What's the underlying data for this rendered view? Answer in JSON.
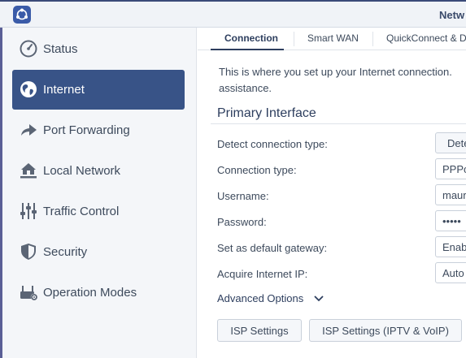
{
  "window": {
    "title": "Netw"
  },
  "sidebar": {
    "items": [
      {
        "label": "Status",
        "icon": "gauge-icon"
      },
      {
        "label": "Internet",
        "icon": "globe-icon"
      },
      {
        "label": "Port Forwarding",
        "icon": "forward-arrow-icon"
      },
      {
        "label": "Local Network",
        "icon": "home-network-icon"
      },
      {
        "label": "Traffic Control",
        "icon": "sliders-icon"
      },
      {
        "label": "Security",
        "icon": "shield-icon"
      },
      {
        "label": "Operation Modes",
        "icon": "router-gear-icon"
      }
    ],
    "active": "Internet"
  },
  "tabs": [
    {
      "label": "Connection"
    },
    {
      "label": "Smart WAN"
    },
    {
      "label": "QuickConnect & D"
    }
  ],
  "main": {
    "description_line1": "This is where you set up your Internet connection.",
    "description_line2": "assistance.",
    "section_title": "Primary Interface",
    "rows": [
      {
        "label": "Detect connection type:",
        "value": "Dete"
      },
      {
        "label": "Connection type:",
        "value": "PPPo"
      },
      {
        "label": "Username:",
        "value": "maur"
      },
      {
        "label": "Password:",
        "value": "•••••"
      },
      {
        "label": "Set as default gateway:",
        "value": "Enab"
      },
      {
        "label": "Acquire Internet IP:",
        "value": "Auto"
      }
    ],
    "advanced_label": "Advanced Options",
    "buttons": [
      {
        "label": "ISP Settings"
      },
      {
        "label": "ISP Settings (IPTV & VoIP)"
      }
    ]
  },
  "colors": {
    "accent": "#385387",
    "sidebar_bg": "#f4f6f9",
    "text": "#3d4a5c"
  }
}
